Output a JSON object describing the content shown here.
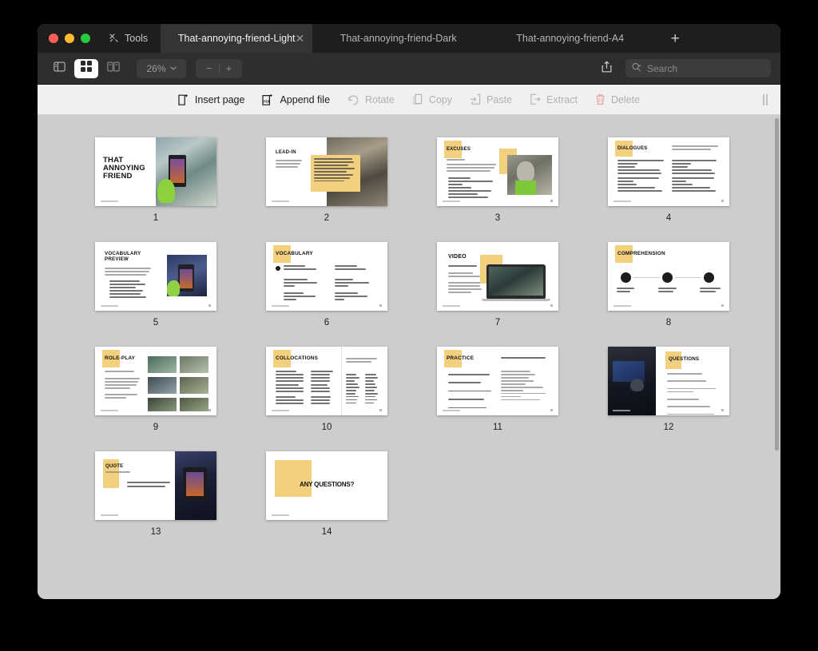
{
  "window": {
    "traffic_lights": [
      "close",
      "minimize",
      "zoom"
    ],
    "tools_label": "Tools",
    "tools_icon": "tools-icon"
  },
  "tabs": [
    {
      "label": "That-annoying-friend-Light",
      "active": true,
      "closable": true
    },
    {
      "label": "That-annoying-friend-Dark",
      "active": false,
      "closable": false
    },
    {
      "label": "That-annoying-friend-A4",
      "active": false,
      "closable": false
    }
  ],
  "new_tab_label": "+",
  "view_toolbar": {
    "sidebar_icon": "sidebar-toggle-icon",
    "grid_icon": "thumbnail-grid-icon",
    "split_icon": "split-view-icon",
    "zoom_level": "26%",
    "zoom_caret": "⌄",
    "zoom_out_label": "−",
    "zoom_in_label": "+",
    "share_icon": "share-icon",
    "search_icon": "search-icon",
    "search_placeholder": "Search",
    "search_value": ""
  },
  "action_toolbar": {
    "items": [
      {
        "label": "Insert page",
        "icon": "insert-page-icon",
        "enabled": true
      },
      {
        "label": "Append file",
        "icon": "append-file-icon",
        "enabled": true
      },
      {
        "label": "Rotate",
        "icon": "rotate-icon",
        "enabled": false
      },
      {
        "label": "Copy",
        "icon": "copy-icon",
        "enabled": false
      },
      {
        "label": "Paste",
        "icon": "paste-icon",
        "enabled": false
      },
      {
        "label": "Extract",
        "icon": "extract-icon",
        "enabled": false
      },
      {
        "label": "Delete",
        "icon": "trash-icon",
        "enabled": false
      }
    ],
    "grip_icon": "drag-grip-icon"
  },
  "colors": {
    "window_chrome": "#1e1e1e",
    "toolbar_dark": "#2e2e2e",
    "toolbar_light": "#f0f0f0",
    "canvas": "#cdcdcd",
    "accent_yellow": "#f3d07e",
    "delete_red": "#e8a1a1"
  },
  "pages": [
    {
      "number": "1",
      "title": "THAT\nANNOYING\nFRIEND",
      "layout": "cover-photo-right"
    },
    {
      "number": "2",
      "title": "LEAD-IN",
      "layout": "text-left-photo-right-note"
    },
    {
      "number": "3",
      "title": "EXCUSES",
      "layout": "title-badge-text-photo"
    },
    {
      "number": "4",
      "title": "DIALOGUES",
      "layout": "two-column-dialogue"
    },
    {
      "number": "5",
      "title": "VOCABULARY\nPREVIEW",
      "layout": "checklist-photo-right"
    },
    {
      "number": "6",
      "title": "VOCABULARY",
      "layout": "two-column-definitions"
    },
    {
      "number": "7",
      "title": "VIDEO",
      "layout": "video-laptop"
    },
    {
      "number": "8",
      "title": "COMPREHENSION",
      "layout": "three-step-timeline"
    },
    {
      "number": "9",
      "title": "ROLE-PLAY",
      "layout": "text-left-photo-grid"
    },
    {
      "number": "10",
      "title": "COLLOCATIONS",
      "layout": "gapfill-wordbank"
    },
    {
      "number": "11",
      "title": "PRACTICE",
      "layout": "matching-exercise"
    },
    {
      "number": "12",
      "title": "QUESTIONS",
      "layout": "photo-left-numbered-list"
    },
    {
      "number": "13",
      "title": "QUOTE",
      "layout": "quote-photo-right"
    },
    {
      "number": "14",
      "title": "ANY QUESTIONS?",
      "layout": "closing"
    }
  ],
  "page_captions": {
    "p2_subtitle": "What do you say to your friends if you don't want to do these things?",
    "p3_subtitle": "What's an excuse?",
    "p4_subtitle": "Read the dialogues and underline the excuses used in each one.",
    "p5_subtitle": "Read the phrases and tell your teacher which ones you know. Choose the ones you don't know in the next activity.",
    "p7_subtitle": "That Annoying Friend",
    "p10_subtitle": "Complete each phrase using 2 words found on this page.",
    "p11_subtitle": "Match the sentences with suitable responses.",
    "p13_subtitle": "What does this quote mean?",
    "p13_quote": "“Some people talk too much and say too little.”"
  }
}
